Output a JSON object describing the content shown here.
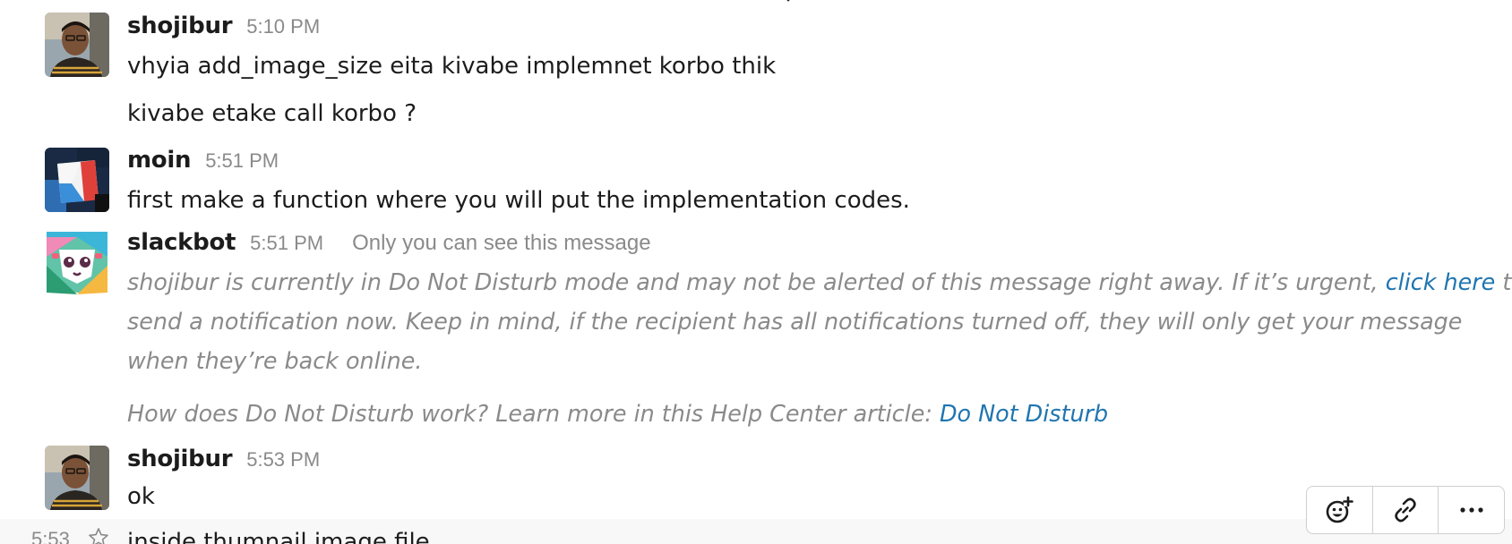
{
  "messages": [
    {
      "author": "shojibur",
      "time": "5:10 PM",
      "avatar_icon": "person-photo-avatar-icon",
      "lines": [
        "vhyia add_image_size eita kivabe implemnet korbo thik"
      ],
      "followup": "kivabe etake call korbo ?"
    },
    {
      "author": "moin",
      "time": "5:51 PM",
      "avatar_icon": "color-blocks-avatar-icon",
      "lines": [
        "first make a function where you will put the implementation codes."
      ]
    },
    {
      "author": "slackbot",
      "time": "5:51 PM",
      "avatar_icon": "slackbot-avatar-icon",
      "ephemeral_note": "Only you can see this message",
      "dnd_text_1a": "shojibur is currently in Do Not Disturb mode and may not be alerted of this message right away. If it’s urgent, ",
      "dnd_link_1": "click here",
      "dnd_text_1b": " to",
      "dnd_text_2": "send a notification now. Keep in mind, if the recipient has all notifications turned off, they will only get your message",
      "dnd_text_3": "when they’re back online.",
      "help_text": "How does Do Not Disturb work? Learn more in this Help Center article: ",
      "help_link": "Do Not Disturb"
    },
    {
      "author": "shojibur",
      "time": "5:53 PM",
      "avatar_icon": "person-photo-avatar-icon",
      "lines": [
        "ok"
      ]
    }
  ],
  "hovered_message": {
    "time": "5:53",
    "text": "inside thumnail image file"
  },
  "actions": {
    "add_reaction": "add-reaction-icon",
    "copy_link": "link-icon",
    "more": "more-actions-icon"
  },
  "colors": {
    "link": "#1f75b0",
    "muted": "#8a8a8a",
    "text": "#1d1c1d"
  }
}
